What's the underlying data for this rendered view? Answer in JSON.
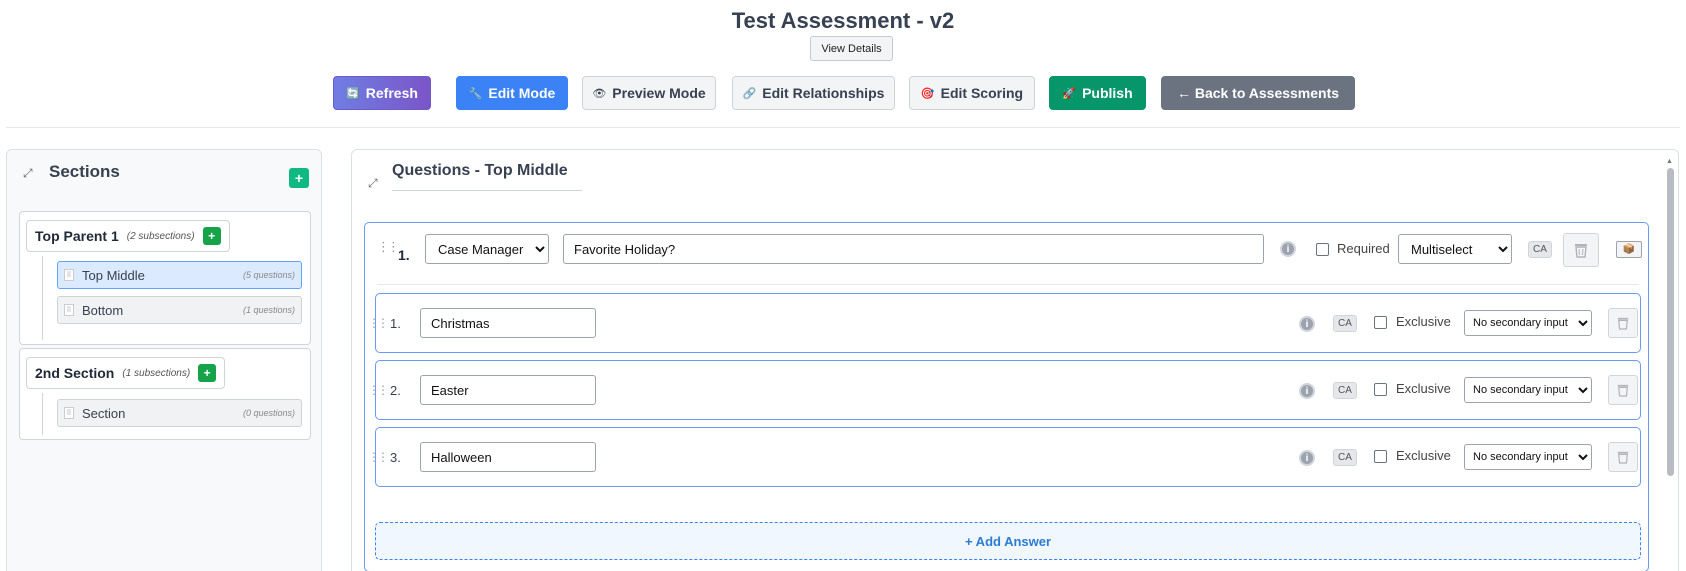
{
  "header": {
    "title": "Test Assessment - v2",
    "view_details": "View Details"
  },
  "toolbar": {
    "refresh": "Refresh",
    "edit_mode": "Edit Mode",
    "preview_mode": "Preview Mode",
    "edit_relationships": "Edit Relationships",
    "edit_scoring": "Edit Scoring",
    "publish": "Publish",
    "back": "← Back to Assessments"
  },
  "colors": {
    "primary": "#3b82f6",
    "publish": "#079669",
    "back": "#6b7280",
    "add": "#16a34a"
  },
  "sections_panel": {
    "title": "Sections",
    "groups": [
      {
        "name": "Top Parent 1",
        "count": "(2 subsections)",
        "subsections": [
          {
            "name": "Top Middle",
            "count": "(5 questions)",
            "active": true
          },
          {
            "name": "Bottom",
            "count": "(1 questions)",
            "active": false
          }
        ]
      },
      {
        "name": "2nd Section",
        "count": "(1 subsections)",
        "subsections": [
          {
            "name": "Section",
            "count": "(0 questions)",
            "active": false
          }
        ]
      }
    ]
  },
  "questions_panel": {
    "title": "Questions - Top Middle",
    "question": {
      "number": "1.",
      "role": "Case Manager",
      "text": "Favorite Holiday?",
      "required_label": "Required",
      "type": "Multiselect",
      "ca": "CA",
      "answers": [
        {
          "number": "1.",
          "text": "Christmas",
          "ca": "CA",
          "exclusive_label": "Exclusive",
          "secondary": "No secondary input"
        },
        {
          "number": "2.",
          "text": "Easter",
          "ca": "CA",
          "exclusive_label": "Exclusive",
          "secondary": "No secondary input"
        },
        {
          "number": "3.",
          "text": "Halloween",
          "ca": "CA",
          "exclusive_label": "Exclusive",
          "secondary": "No secondary input"
        }
      ],
      "add_answer": "+ Add Answer"
    }
  }
}
